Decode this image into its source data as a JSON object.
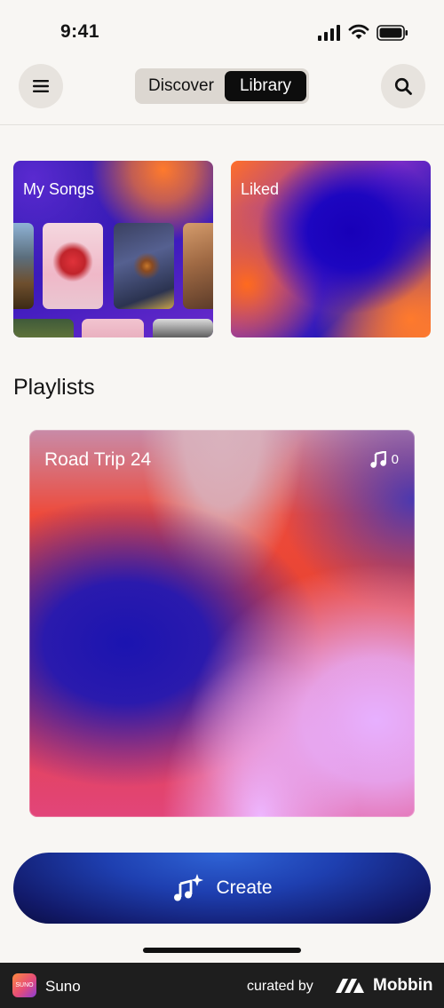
{
  "status_bar": {
    "time": "9:41"
  },
  "header": {
    "tabs": [
      {
        "label": "Discover",
        "active": false
      },
      {
        "label": "Library",
        "active": true
      }
    ],
    "menu_icon": "hamburger-menu-icon",
    "search_icon": "search-icon"
  },
  "library": {
    "my_songs": {
      "title": "My Songs"
    },
    "liked": {
      "title": "Liked"
    }
  },
  "playlists": {
    "title": "Playlists",
    "items": [
      {
        "name": "Road Trip 24",
        "count": "0"
      }
    ]
  },
  "create_button": {
    "label": "Create"
  },
  "footer": {
    "app_name": "Suno",
    "curated_by": "curated by",
    "brand": "Mobbin"
  },
  "colors": {
    "accent_orange": "#ff7a2c",
    "accent_blue": "#1d06c0",
    "create_blue": "#1e3fb0"
  }
}
